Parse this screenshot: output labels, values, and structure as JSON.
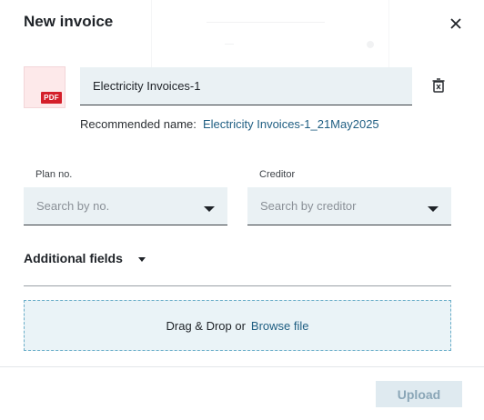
{
  "dialog": {
    "title": "New invoice"
  },
  "file": {
    "badge": "PDF",
    "name_value": "Electricity Invoices-1",
    "recommended_label": "Recommended name:",
    "recommended_value": "Electricity Invoices-1_21May2025"
  },
  "fields": {
    "plan_label": "Plan no.",
    "plan_placeholder": "Search by no.",
    "creditor_label": "Creditor",
    "creditor_placeholder": "Search by creditor"
  },
  "additional": {
    "label": "Additional fields"
  },
  "dropzone": {
    "text": "Drag & Drop or",
    "link": "Browse file"
  },
  "footer": {
    "upload_label": "Upload"
  },
  "icons": {
    "close": "close-icon",
    "trash": "delete-file-icon"
  },
  "colors": {
    "accent": "#1f5e82",
    "pdf_red": "#d41f2a",
    "field_bg": "#eaf1f4",
    "upload_disabled_bg": "#dfeaf0"
  }
}
